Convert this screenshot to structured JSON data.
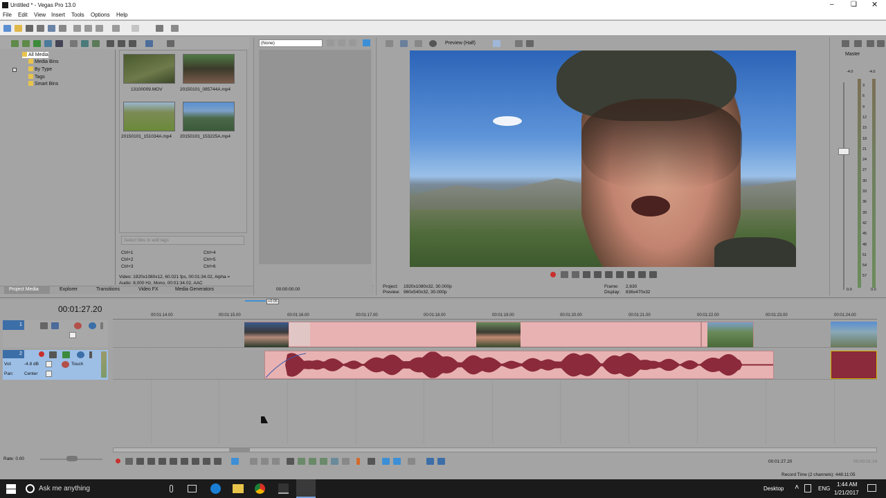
{
  "window": {
    "title": "Untitled * - Vegas Pro 13.0"
  },
  "menu": [
    "File",
    "Edit",
    "View",
    "Insert",
    "Tools",
    "Options",
    "Help"
  ],
  "explorer": {
    "tree": [
      "All Media",
      "Media Bins",
      "By Type",
      "Tags",
      "Smart Bins"
    ],
    "media": [
      {
        "name": "13100009.MOV"
      },
      {
        "name": "20150101_085744A.mp4"
      },
      {
        "name": "20150101_151034A.mp4"
      },
      {
        "name": "20150101_153225A.mp4"
      }
    ],
    "tags_placeholder": "Select files to edit tags",
    "shortcuts": [
      "Ctrl+1",
      "Ctrl+4",
      "Ctrl+2",
      "Ctrl+5",
      "Ctrl+3",
      "Ctrl+6"
    ],
    "info_video": "Video: 1920x1080x12, 60.021 fps, 00:01:34.02, Alpha =",
    "info_audio": "Audio: 8,000 Hz, Mono, 00:01:34.02, AAC"
  },
  "tabs": [
    "Project Media",
    "Explorer",
    "Transitions",
    "Video FX",
    "Media Generators"
  ],
  "trimmer": {
    "dropdown": "(None)",
    "timecode": "00:00:00.00"
  },
  "preview": {
    "mode": "Preview (Half)",
    "project": "Project:",
    "project_val": "1920x1080x32, 30.000p",
    "preview": "Preview:",
    "preview_val": "960x540x32, 30.000p",
    "frame": "Frame:",
    "frame_val": "2,630",
    "display": "Display:",
    "display_val": "836x470x32"
  },
  "master": {
    "label": "Master",
    "ticks": [
      "3",
      "6",
      "9",
      "12",
      "15",
      "18",
      "21",
      "24",
      "27",
      "30",
      "33",
      "36",
      "39",
      "42",
      "45",
      "48",
      "51",
      "54",
      "57"
    ],
    "top_l": "-4.0",
    "top_r": "-4.0",
    "bot_l": "0.0",
    "bot_r": "0.0"
  },
  "timeline": {
    "timecode": "00:01:27.20",
    "marker": "+0:05",
    "ruler": [
      "00:01:14.00",
      "00:01:15.00",
      "00:01:16.00",
      "00:01:17.00",
      "00:01:18.00",
      "00:01:19.00",
      "00:01:20.00",
      "00:01:21.00",
      "00:01:22.00",
      "00:01:23.00",
      "00:01:24.00"
    ],
    "track1": {
      "num": "1"
    },
    "track2": {
      "num": "2",
      "vol_label": "Vol:",
      "vol_val": "-4.8 dB",
      "touch": "Touch",
      "pan_label": "Pan:",
      "pan_val": "Center"
    }
  },
  "transport": {
    "rate": "Rate: 0.00",
    "time": "00:01:27.20",
    "end": "00:00:01:24",
    "record": "Record Time (2 channels): 448:11:05"
  },
  "taskbar": {
    "search": "Ask me anything",
    "desktop": "Desktop",
    "lang": "ENG",
    "time": "1:44 AM",
    "date": "1/21/2017"
  },
  "colors": {
    "accent": "#3c8fd6",
    "clip": "#e8b2b2",
    "wave": "#8a2a3a",
    "track_hdr": "#9dbfe6"
  }
}
